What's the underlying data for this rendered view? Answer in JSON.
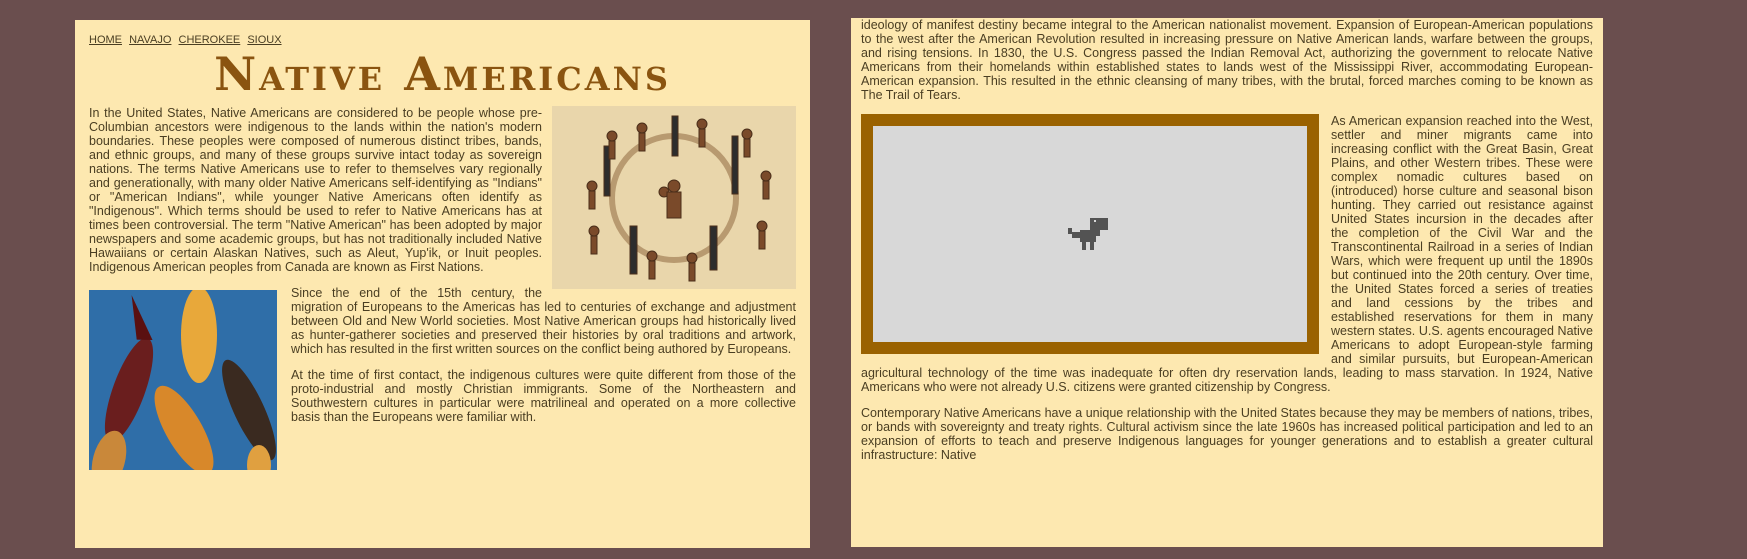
{
  "nav": {
    "links": [
      "HOME",
      "NAVAJO",
      "CHEROKEE",
      "SIOUX"
    ]
  },
  "page": {
    "title": "Native Americans"
  },
  "left": {
    "p1": "In the United States, Native Americans are considered to be people whose pre-Columbian ancestors were indigenous to the lands within the nation's modern boundaries. These peoples were composed of numerous distinct tribes, bands, and ethnic groups, and many of these groups survive intact today as sovereign nations. The terms Native Americans use to refer to themselves vary regionally and generationally, with many older Native Americans self-identifying as \"Indians\" or \"American Indians\", while younger Native Americans often identify as \"Indigenous\". Which terms should be used to refer to Native Americans has at times been controversial. The term \"Native American\" has been adopted by major newspapers and some academic groups, but has not traditionally included Native Hawaiians or certain Alaskan Natives, such as Aleut, Yup'ik, or Inuit peoples. Indigenous American peoples from Canada are known as First Nations.",
    "p2": "Since the end of the 15th century, the migration of Europeans to the Americas has led to centuries of exchange and adjustment between Old and New World societies. Most Native American groups had historically lived as hunter-gatherer societies and preserved their histories by oral traditions and artwork, which has resulted in the first written sources on the conflict being authored by Europeans.",
    "p3": "At the time of first contact, the indigenous cultures were quite different from those of the proto-industrial and mostly Christian immigrants. Some of the Northeastern and Southwestern cultures in particular were matrilineal and operated on a more collective basis than the Europeans were familiar with."
  },
  "right": {
    "p1": "ideology of manifest destiny became integral to the American nationalist movement. Expansion of European-American populations to the west after the American Revolution resulted in increasing pressure on Native American lands, warfare between the groups, and rising tensions. In 1830, the U.S. Congress passed the Indian Removal Act, authorizing the government to relocate Native Americans from their homelands within established states to lands west of the Mississippi River, accommodating European-American expansion. This resulted in the ethnic cleansing of many tribes, with the brutal, forced marches coming to be known as The Trail of Tears.",
    "p2": "As American expansion reached into the West, settler and miner migrants came into increasing conflict with the Great Basin, Great Plains, and other Western tribes. These were complex nomadic cultures based on (introduced) horse culture and seasonal bison hunting. They carried out resistance against United States incursion in the decades after the completion of the Civil War and the Transcontinental Railroad in a series of Indian Wars, which were frequent up until the 1890s but continued into the 20th century. Over time, the United States forced a series of treaties and land cessions by the tribes and established reservations for them in many western states. U.S. agents encouraged Native Americans to adopt European-style farming and similar pursuits, but European-American agricultural technology of the time was inadequate for often dry reservation lands, leading to mass starvation. In 1924, Native Americans who were not already U.S. citizens were granted citizenship by Congress.",
    "p3": "Contemporary Native Americans have a unique relationship with the United States because they may be members of nations, tribes, or bands with sovereignty and treaty rights. Cultural activism since the late 1960s has increased political participation and led to an expansion of efforts to teach and preserve Indigenous languages for younger generations and to establish a greater cultural infrastructure: Native"
  }
}
